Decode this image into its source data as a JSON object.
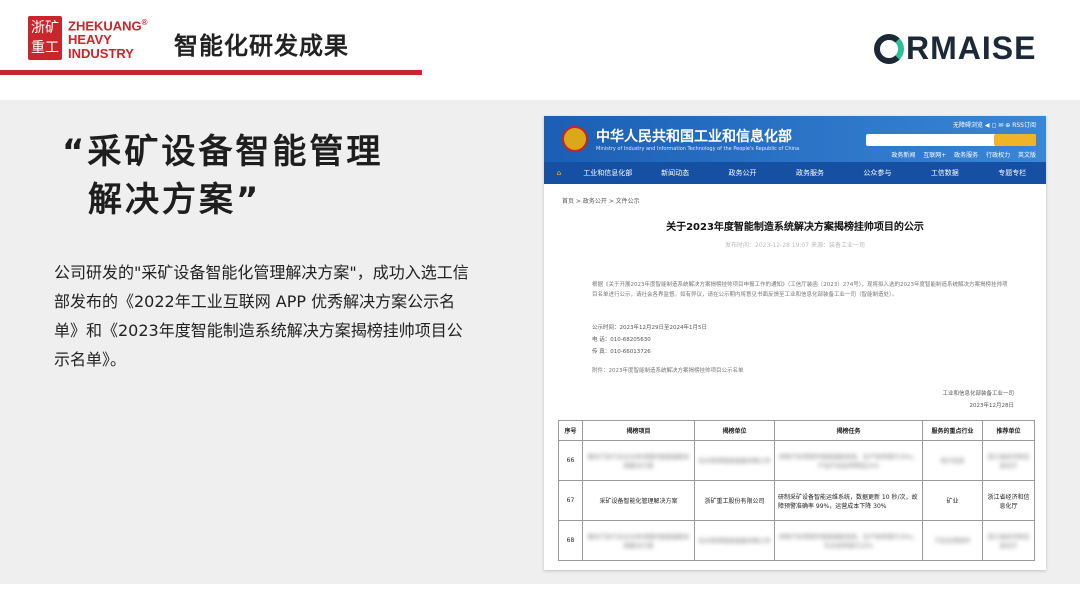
{
  "header": {
    "logo_cn": "浙矿重工",
    "logo_lines": [
      "ZHEKUANG",
      "HEAVY",
      "INDUSTRY"
    ],
    "logo_reg": "®",
    "title": "智能化研发成果",
    "partner_logo": "RMAISE"
  },
  "main": {
    "quote_line1": "“采矿设备智能管理",
    "quote_line2": "解决方案”",
    "description": "公司研发的\"采矿设备智能化管理解决方案\"，成功入选工信部发布的《2022年工业互联网 APP 优秀解决方案公示名单》和《2023年度智能制造系统解决方案揭榜挂帅项目公示名单》。"
  },
  "document": {
    "site_name": "中华人民共和国工业和信息化部",
    "site_name_en": "Ministry of Industry and Information Technology of the People's Republic of China",
    "tools": "无障碍浏览  ◀  ◻  ✉  ⊕  RSS订阅",
    "top_links": "政务新闻  互联网+  政务服务  行政权力  英文版",
    "nav": [
      "工业和信息化部",
      "新闻动态",
      "政务公开",
      "政务服务",
      "公众参与",
      "工信数据",
      "专题专栏"
    ],
    "breadcrumb": "首页 > 政务公开 > 文件公示",
    "title": "关于2023年度智能制造系统解决方案揭榜挂帅项目的公示",
    "meta": "发布时间：2023-12-28 19:07    来源：装备工业一司",
    "body": "根据《关于开展2023年度智能制造系统解决方案揭榜挂帅项目申报工作的通知》（工信厅装函〔2023〕274号），现将拟入选的2023年度智能制造系统解决方案揭榜挂帅项目名单进行公示，请社会各界监督。如有异议，请在公示期内将意见书面反馈至工业和信息化部装备工业一司（智能制造处）。",
    "info": [
      "公示时间：2023年12月29日至2024年1月5日",
      "电    话：010-68205630",
      "传    真：010-66013726"
    ],
    "attachment": "附件：2023年度智能制造系统解决方案揭榜挂帅项目公示名单",
    "sign_dept": "工业和信息化部装备工业一司",
    "sign_date": "2023年12月28日",
    "table": {
      "headers": [
        "序号",
        "揭榜项目",
        "揭榜单位",
        "揭榜任务",
        "服务的重点行业",
        "推荐单位"
      ],
      "rows": [
        {
          "no": "66",
          "project": "面向汽车行业全业务流程的智能装配系统解决方案",
          "unit": "杭州某某智能装备有限公司",
          "task": "研制汽车零部件智能装配系统，生产效率提升30%，产品不良品率降低20%",
          "industry": "电子信息",
          "recommender": "浙江省经济和信息化厅"
        },
        {
          "no": "67",
          "project": "采矿设备智能化管理解决方案",
          "unit": "浙矿重工股份有限公司",
          "task": "研制采矿设备智能运维系统，数据更新 10 秒/次，故障预警准确率 99%，运营成本下降 30%",
          "industry": "矿业",
          "recommender": "浙江省经济和信息化厅"
        },
        {
          "no": "68",
          "project": "面向汽车行业全业务流程的智能装配系统解决方案",
          "unit": "杭州某某智能装备有限公司",
          "task": "研制汽车零部件智能装配系统，生产效率提升30%，作业效率提升20%",
          "industry": "汽车及零部件",
          "recommender": "浙江省经济和信息化厅"
        }
      ]
    }
  },
  "colors": {
    "brand_red": "#c8262c",
    "panel_gray": "#efefef",
    "gov_blue": "#1b5fb5"
  }
}
